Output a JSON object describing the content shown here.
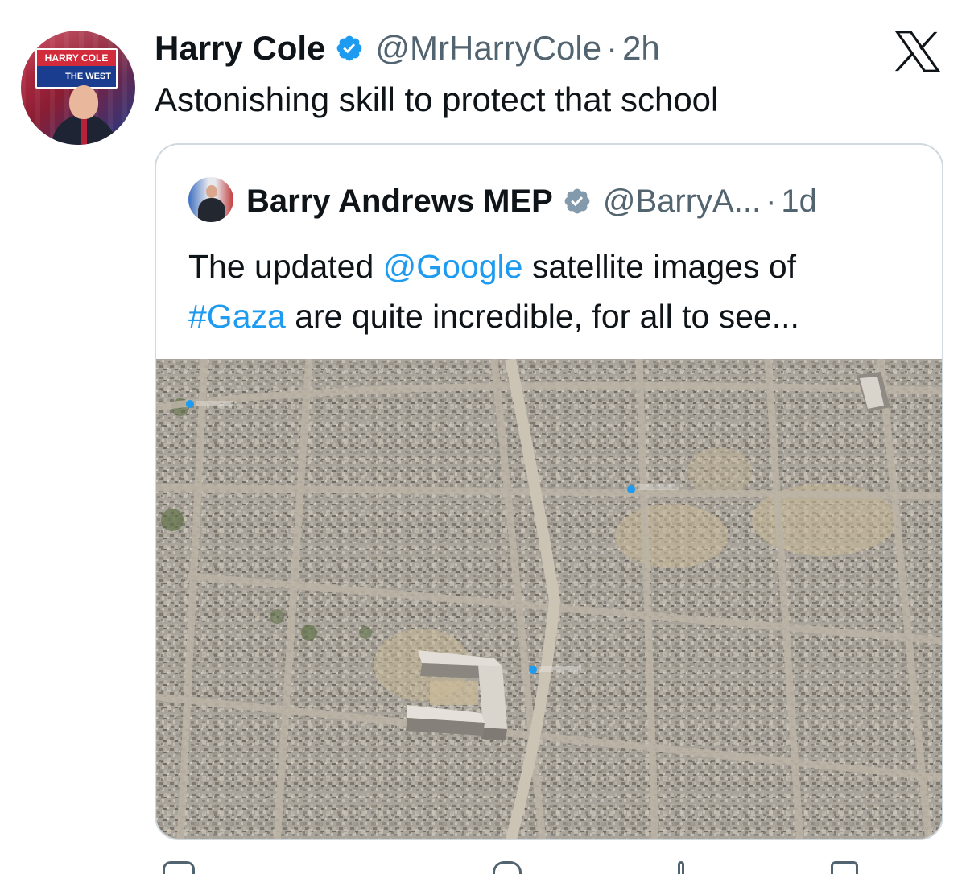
{
  "tweet": {
    "author_name": "Harry Cole",
    "author_handle": "@MrHarryCole",
    "separator": "·",
    "time": "2h",
    "text": "Astonishing skill to protect that school",
    "avatar_sign_top": "HARRY COLE",
    "avatar_sign_bottom": "THE WEST"
  },
  "quoted_tweet": {
    "author_name": "Barry Andrews MEP",
    "author_handle": "@BarryA...",
    "separator": "·",
    "time": "1d",
    "text_before_mention": "The updated ",
    "mention": "@Google",
    "text_after_mention": " satellite images of",
    "hashtag": "#Gaza",
    "text_after_hashtag": " are quite incredible, for all to see..."
  },
  "colors": {
    "text": "#0f1419",
    "secondary": "#536471",
    "link": "#1d9bf0",
    "verified_badge": "#1d9bf0",
    "quote_verified_badge": "#829aab",
    "border": "#cfd9de"
  },
  "icons": {
    "logo": "x-logo-icon",
    "verified": "verified-badge-icon"
  }
}
